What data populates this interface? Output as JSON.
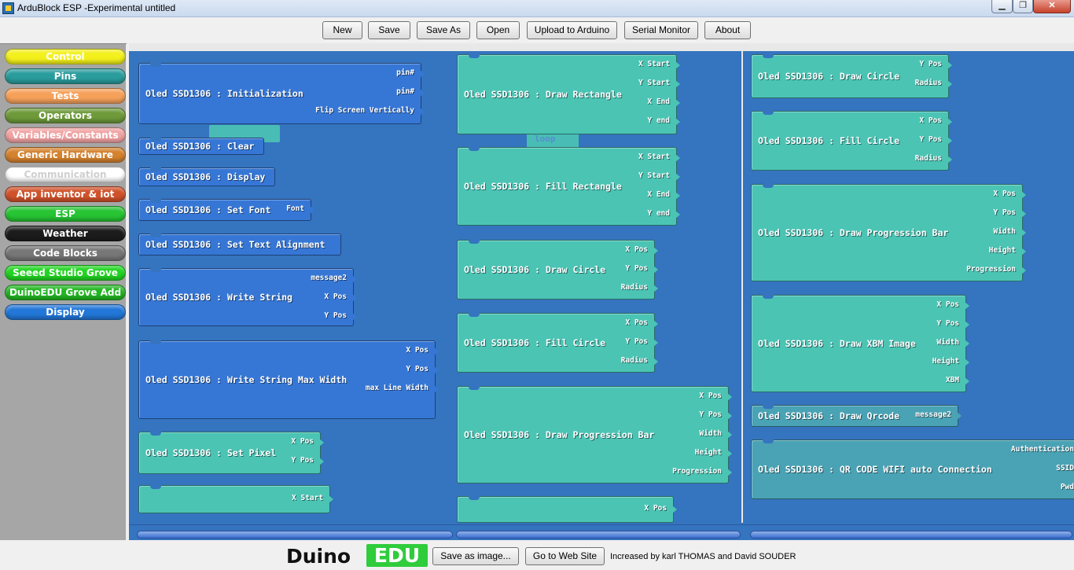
{
  "window": {
    "title": "ArduBlock ESP -Experimental untitled"
  },
  "toolbar": {
    "new": "New",
    "save": "Save",
    "save_as": "Save As",
    "open": "Open",
    "upload": "Upload to Arduino",
    "serial": "Serial Monitor",
    "about": "About"
  },
  "palette": [
    {
      "label": "Control",
      "bg": "#f3f01c",
      "fg": "#ffffff"
    },
    {
      "label": "Pins",
      "bg": "#2a9c9c",
      "fg": "#ffffff"
    },
    {
      "label": "Tests",
      "bg": "#f6a15a",
      "fg": "#ffffff"
    },
    {
      "label": "Operators",
      "bg": "#6e9a3a",
      "fg": "#ffffff"
    },
    {
      "label": "Variables/Constants",
      "bg": "#f1a3a3",
      "fg": "#ffffff"
    },
    {
      "label": "Generic Hardware",
      "bg": "#d4822e",
      "fg": "#ffffff"
    },
    {
      "label": "Communication",
      "bg": "#ffffff",
      "fg": "#cfcfcf"
    },
    {
      "label": "App inventor & iot",
      "bg": "#d0522a",
      "fg": "#ffffff"
    },
    {
      "label": "ESP",
      "bg": "#27c433",
      "fg": "#ffffff"
    },
    {
      "label": "Weather",
      "bg": "#1c1c1c",
      "fg": "#ffffff"
    },
    {
      "label": "Code Blocks",
      "bg": "#777777",
      "fg": "#ffffff"
    },
    {
      "label": "Seeed Studio Grove",
      "bg": "#22d522",
      "fg": "#ffffff"
    },
    {
      "label": "DuinoEDU Grove Add",
      "bg": "#23b623",
      "fg": "#ffffff"
    },
    {
      "label": "Display",
      "bg": "#2277d8",
      "fg": "#ffffff"
    }
  ],
  "blocks": {
    "col1": [
      {
        "title": "Oled SSD1306 : Initialization",
        "sockets": [
          "pin#",
          "pin#",
          "Flip Screen Vertically"
        ]
      },
      {
        "title": "Oled SSD1306 : Clear",
        "sockets": []
      },
      {
        "title": "Oled SSD1306 : Display",
        "sockets": []
      },
      {
        "title": "Oled SSD1306 : Set Font",
        "sockets": [
          "Font"
        ]
      },
      {
        "title": "Oled SSD1306 : Set Text Alignment",
        "sockets": []
      },
      {
        "title": "Oled SSD1306 : Write String",
        "sockets": [
          "message2",
          "X Pos",
          "Y Pos"
        ]
      },
      {
        "title": "Oled SSD1306 : Write String Max Width",
        "sockets": [
          "X Pos",
          "Y Pos",
          "max Line Width"
        ]
      },
      {
        "title": "Oled SSD1306 : Set Pixel",
        "sockets": [
          "X Pos",
          "Y Pos"
        ]
      },
      {
        "title": "",
        "sockets": [
          "X Start"
        ]
      }
    ],
    "col2": [
      {
        "title": "Oled SSD1306 : Draw Rectangle",
        "sockets": [
          "X Start",
          "Y Start",
          "X End",
          "Y end"
        ]
      },
      {
        "title": "Oled SSD1306 : Fill Rectangle",
        "sockets": [
          "X Start",
          "Y Start",
          "X End",
          "Y end"
        ]
      },
      {
        "title": "Oled SSD1306 : Draw Circle",
        "sockets": [
          "X Pos",
          "Y Pos",
          "Radius"
        ]
      },
      {
        "title": "Oled SSD1306 : Fill Circle",
        "sockets": [
          "X Pos",
          "Y Pos",
          "Radius"
        ]
      },
      {
        "title": "Oled SSD1306 : Draw Progression Bar",
        "sockets": [
          "X Pos",
          "Y Pos",
          "Width",
          "Height",
          "Progression"
        ]
      },
      {
        "title": "",
        "sockets": [
          "X Pos"
        ]
      }
    ],
    "col3": [
      {
        "title": "Oled SSD1306 : Draw Circle",
        "sockets": [
          "Y Pos",
          "Radius"
        ]
      },
      {
        "title": "Oled SSD1306 : Fill Circle",
        "sockets": [
          "X Pos",
          "Y Pos",
          "Radius"
        ]
      },
      {
        "title": "Oled SSD1306 : Draw Progression Bar",
        "sockets": [
          "X Pos",
          "Y Pos",
          "Width",
          "Height",
          "Progression"
        ]
      },
      {
        "title": "Oled SSD1306 : Draw XBM Image",
        "sockets": [
          "X Pos",
          "Y Pos",
          "Width",
          "Height",
          "XBM"
        ]
      },
      {
        "title": "Oled SSD1306 : Draw Qrcode",
        "sockets": [
          "message2"
        ]
      },
      {
        "title": "Oled SSD1306 : QR CODE WIFI auto Connection",
        "sockets": [
          "Authentication",
          "SSID",
          "Pwd"
        ]
      }
    ]
  },
  "ghost": {
    "loop_label": "loop"
  },
  "bottom": {
    "logo_a": "Duino",
    "logo_b": "EDU",
    "save_image": "Save as image...",
    "web": "Go to Web Site",
    "credits": "Increased by karl THOMAS and David SOUDER"
  }
}
